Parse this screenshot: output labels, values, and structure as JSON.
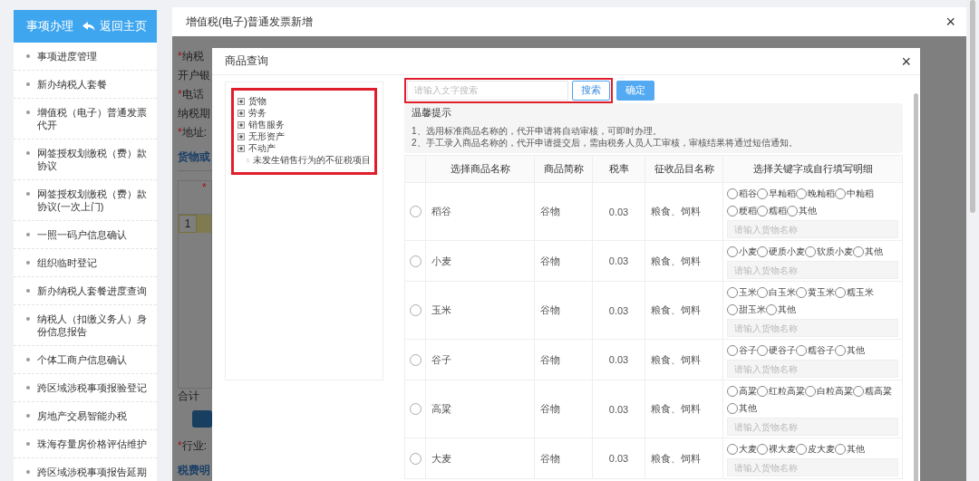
{
  "sidebar": {
    "title": "事项办理",
    "back_link": "返回主页",
    "items": [
      {
        "label": "事项进度管理"
      },
      {
        "label": "新办纳税人套餐"
      },
      {
        "label": "增值税（电子）普通发票代开"
      },
      {
        "label": "网签授权划缴税（费）款协议"
      },
      {
        "label": "网签授权划缴税（费）款协议(一次上门)"
      },
      {
        "label": "一照一码户信息确认"
      },
      {
        "label": "组织临时登记"
      },
      {
        "label": "新办纳税人套餐进度查询"
      },
      {
        "label": "纳税人（扣缴义务人）身份信息报告"
      },
      {
        "label": "个体工商户信息确认"
      },
      {
        "label": "跨区域涉税事项报验登记"
      },
      {
        "label": "房地产交易智能办税"
      },
      {
        "label": "珠海存量房价格评估维护"
      },
      {
        "label": "跨区域涉税事项报告延期"
      }
    ]
  },
  "main": {
    "title": "增值税(电子)普通发票新增",
    "close": "×",
    "background_form": [
      {
        "kind": "label",
        "mark": "*",
        "text": "纳税"
      },
      {
        "kind": "label",
        "text": "开户银"
      },
      {
        "kind": "label",
        "mark": "*",
        "text": "电话"
      },
      {
        "kind": "label",
        "text": "纳税期"
      },
      {
        "kind": "label",
        "mark": "*",
        "text": "地址:"
      },
      {
        "kind": "section",
        "text": "货物或"
      },
      {
        "kind": "table",
        "mark": "*",
        "row_number": "1"
      },
      {
        "kind": "total",
        "text": "合计"
      },
      {
        "kind": "button"
      },
      {
        "kind": "label",
        "mark": "*",
        "text": "行业:"
      },
      {
        "kind": "section",
        "text": "税费明"
      }
    ]
  },
  "modal": {
    "title": "商品查询",
    "close": "×",
    "tree_highlighted": true,
    "tree": [
      {
        "kind": "branch",
        "label": "货物",
        "expanded": false
      },
      {
        "kind": "branch",
        "label": "劳务",
        "expanded": false
      },
      {
        "kind": "branch",
        "label": "销售服务",
        "expanded": false
      },
      {
        "kind": "branch",
        "label": "无形资产",
        "expanded": false
      },
      {
        "kind": "branch",
        "label": "不动产",
        "expanded": false
      },
      {
        "kind": "leaf",
        "label": "未发生销售行为的不征税项目",
        "expanded": false
      }
    ],
    "search": {
      "placeholder": "请输入文字搜索",
      "highlighted": true
    },
    "buttons": [
      {
        "label": "搜索",
        "kind": "outline"
      },
      {
        "label": "确定",
        "kind": "primary"
      }
    ],
    "tips": {
      "title": "温馨提示",
      "lines": [
        "1、选用标准商品名称的，代开申请将自动审核，可即时办理。",
        "2、手工录入商品名称的，代开申请提交后，需由税务人员人工审核，审核结果将通过短信通知。"
      ]
    },
    "table": {
      "columns": [
        "选择商品名称",
        "商品简称",
        "税率",
        "征收品目名称",
        "选择关键字或自行填写明细"
      ],
      "rows": [
        {
          "selected": false,
          "name": "稻谷",
          "abbr": "谷物",
          "rate": "0.03",
          "category": "粮食、饲料",
          "options": [
            {
              "label": "稻谷",
              "selected": false
            },
            {
              "label": "早籼稻",
              "selected": false
            },
            {
              "label": "晚籼稻",
              "selected": false
            },
            {
              "label": "中籼稻",
              "selected": false
            },
            {
              "label": "粳稻",
              "selected": false
            },
            {
              "label": "糯稻",
              "selected": false
            },
            {
              "label": "其他",
              "selected": false
            }
          ],
          "placeholder": "请输入货物名称"
        },
        {
          "selected": false,
          "name": "小麦",
          "abbr": "谷物",
          "rate": "0.03",
          "category": "粮食、饲料",
          "options": [
            {
              "label": "小麦",
              "selected": false
            },
            {
              "label": "硬质小麦",
              "selected": false
            },
            {
              "label": "软质小麦",
              "selected": false
            },
            {
              "label": "其他",
              "selected": false
            }
          ],
          "placeholder": "请输入货物名称"
        },
        {
          "selected": false,
          "name": "玉米",
          "abbr": "谷物",
          "rate": "0.03",
          "category": "粮食、饲料",
          "options": [
            {
              "label": "玉米",
              "selected": false
            },
            {
              "label": "白玉米",
              "selected": false
            },
            {
              "label": "黄玉米",
              "selected": false
            },
            {
              "label": "糯玉米",
              "selected": false
            },
            {
              "label": "甜玉米",
              "selected": false
            },
            {
              "label": "其他",
              "selected": false
            }
          ],
          "placeholder": "请输入货物名称"
        },
        {
          "selected": false,
          "name": "谷子",
          "abbr": "谷物",
          "rate": "0.03",
          "category": "粮食、饲料",
          "options": [
            {
              "label": "谷子",
              "selected": false
            },
            {
              "label": "硬谷子",
              "selected": false
            },
            {
              "label": "糯谷子",
              "selected": false
            },
            {
              "label": "其他",
              "selected": false
            }
          ],
          "placeholder": "请输入货物名称"
        },
        {
          "selected": false,
          "name": "高粱",
          "abbr": "谷物",
          "rate": "0.03",
          "category": "粮食、饲料",
          "options": [
            {
              "label": "高粱",
              "selected": false
            },
            {
              "label": "红粒高粱",
              "selected": false
            },
            {
              "label": "白粒高粱",
              "selected": false
            },
            {
              "label": "糯高粱",
              "selected": false
            },
            {
              "label": "其他",
              "selected": false
            }
          ],
          "placeholder": "请输入货物名称"
        },
        {
          "selected": false,
          "name": "大麦",
          "abbr": "谷物",
          "rate": "0.03",
          "category": "粮食、饲料",
          "options": [
            {
              "label": "大麦",
              "selected": false
            },
            {
              "label": "裸大麦",
              "selected": false
            },
            {
              "label": "皮大麦",
              "selected": false
            },
            {
              "label": "其他",
              "selected": false
            }
          ],
          "placeholder": "请输入货物名称"
        }
      ]
    }
  }
}
